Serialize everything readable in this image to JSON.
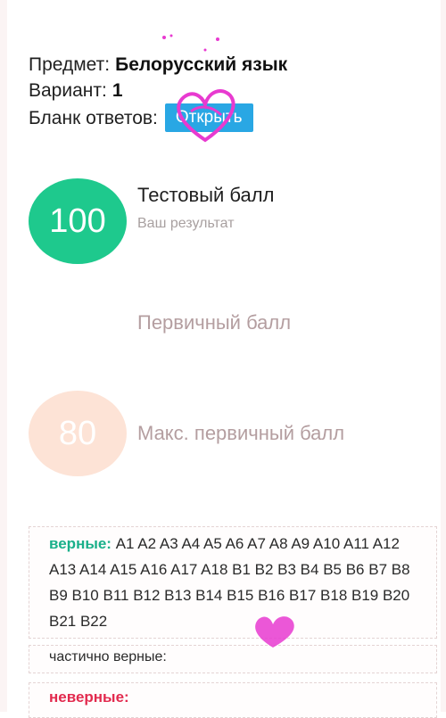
{
  "info": {
    "subject_label": "Предмет:",
    "subject_value": "Белорусский язык",
    "variant_label": "Вариант:",
    "variant_value": "1",
    "answers_label": "Бланк ответов:",
    "open_button": "Открыть"
  },
  "scores": {
    "test": {
      "value": "100",
      "title": "Тестовый балл",
      "subtitle": "Ваш результат"
    },
    "primary": {
      "value": "",
      "title": "Первичный балл"
    },
    "max_primary": {
      "value": "80",
      "title": "Макс. первичный балл"
    }
  },
  "results": {
    "correct_label": "верные:",
    "correct_items": "A1 A2 A3 A4 A5 A6 A7 A8 A9 A10 A11 A12 A13 A14 A15 A16 A17 A18 B1 B2 B3 B4 B5 B6 B7 B8 B9 B10 B11 B12 B13 B14 B15 B16 B17 B18 B19 B20 B21 B22",
    "partial_label": "частично верные:",
    "wrong_label": "неверные:"
  },
  "colors": {
    "accent_green": "#1ec98d",
    "button_blue": "#29a7e4",
    "wrong_red": "#e22a4e",
    "doodle_magenta": "#e83ad0"
  }
}
